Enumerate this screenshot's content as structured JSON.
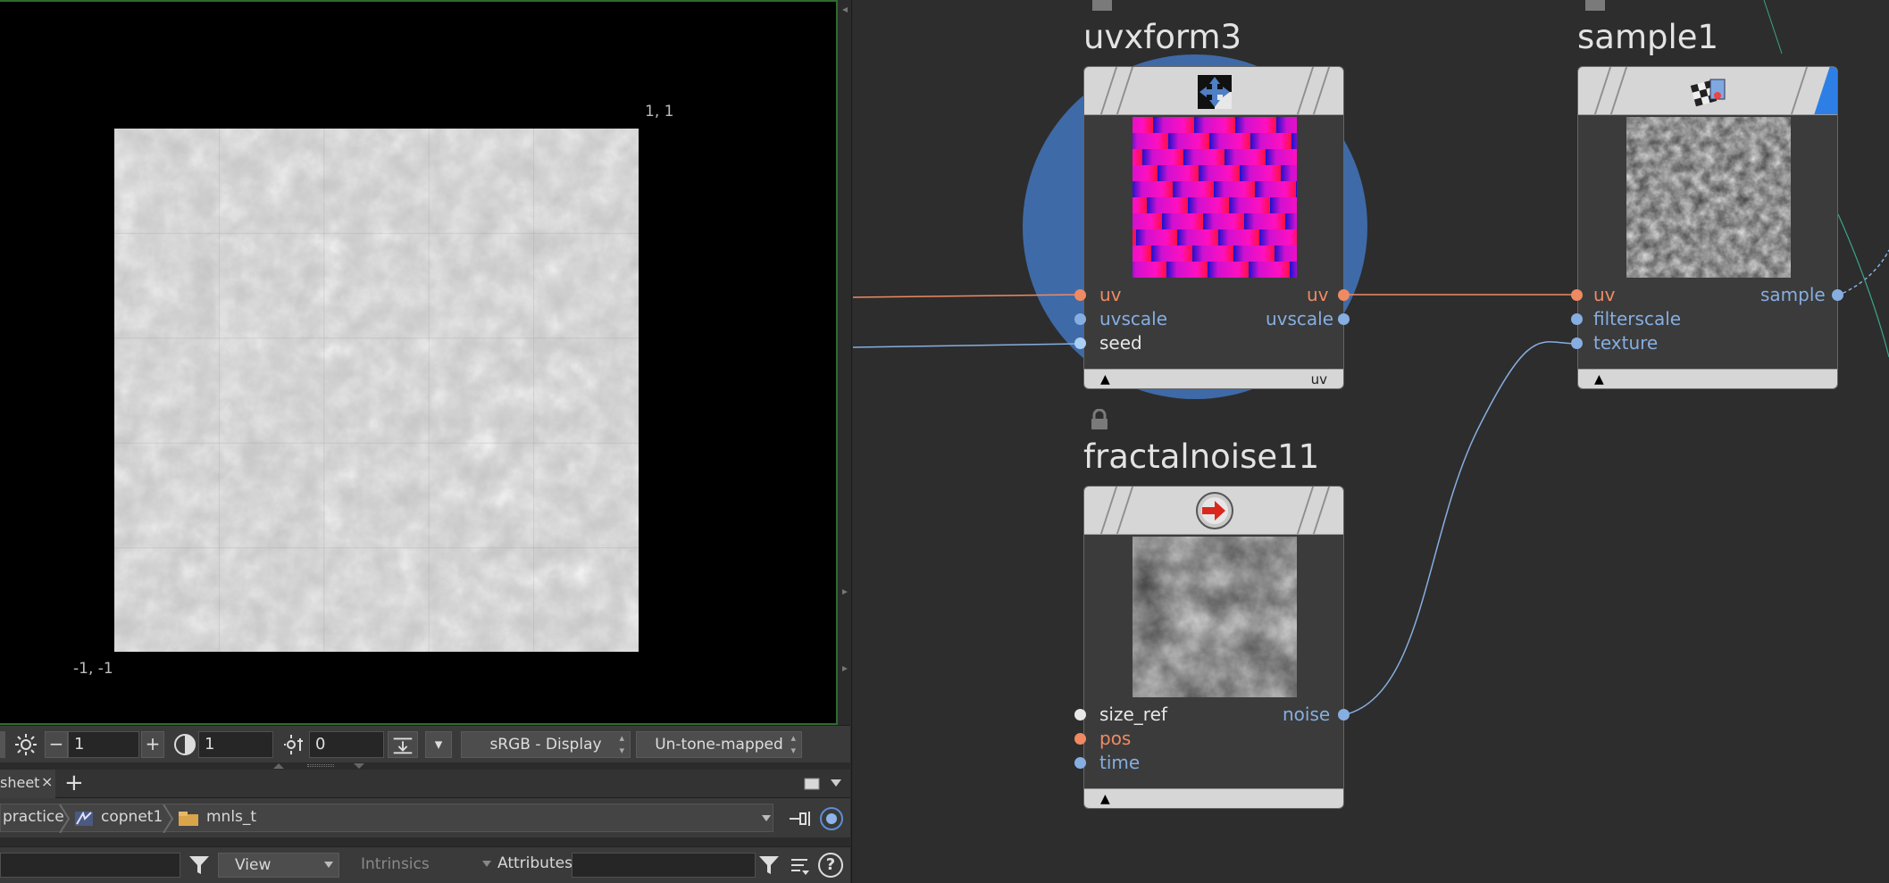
{
  "viewer": {
    "coord_top_right": "1, 1",
    "coord_bottom_left": "-1, -1",
    "exposure_value": "1",
    "gamma_value": "1",
    "offset_value": "0",
    "colorspace": "sRGB - Display",
    "tonemap": "Un-tone-mapped"
  },
  "tabs": {
    "current_tab": "sheet",
    "close_glyph": "×",
    "add_glyph": "+"
  },
  "path": {
    "items": [
      "practice",
      "copnet1",
      "mnls_t"
    ]
  },
  "filterbar": {
    "view_label": "View",
    "intrinsics_label": "Intrinsics",
    "attributes_label": "Attributes:",
    "help_glyph": "?"
  },
  "network": {
    "nodes": [
      {
        "name": "uvxform3",
        "footer_label": "uv",
        "inputs": [
          "uv",
          "uvscale",
          "seed"
        ],
        "outputs": [
          "uv",
          "uvscale"
        ]
      },
      {
        "name": "sample1",
        "footer_label": "",
        "inputs": [
          "uv",
          "filterscale",
          "texture"
        ],
        "outputs": [
          "sample"
        ]
      },
      {
        "name": "fractalnoise11",
        "footer_label": "",
        "inputs": [
          "size_ref",
          "pos",
          "time"
        ],
        "outputs": [
          "noise"
        ]
      }
    ]
  },
  "colors": {
    "uv_port": "#ef8a63",
    "float_port": "#86aee0",
    "selection_disc": "#3f6aa8",
    "viewer_border": "#2e6b2e"
  },
  "icons": {
    "uvxform3": "move-arrows-icon",
    "sample1": "checker-sample-icon",
    "fractalnoise11": "red-arrow-sphere-icon"
  }
}
